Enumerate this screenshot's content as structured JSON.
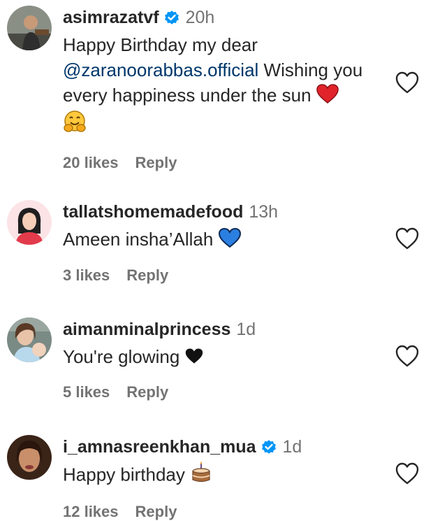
{
  "comments": [
    {
      "username": "asimrazatvf",
      "verified": true,
      "time": "20h",
      "text_line1": "Happy Birthday my dear",
      "mention": "@zaranoorabbas.official",
      "text_after_mention": " Wishing you every happiness under the sun",
      "likes": "20 likes",
      "reply": "Reply"
    },
    {
      "username": "tallatshomemadefood",
      "verified": false,
      "time": "13h",
      "text": "Ameen insha’Allah",
      "likes": "3 likes",
      "reply": "Reply"
    },
    {
      "username": "aimanminalprincess",
      "verified": false,
      "time": "1d",
      "text": "You're glowing",
      "likes": "5 likes",
      "reply": "Reply"
    },
    {
      "username": "i_amnasreenkhan_mua",
      "verified": true,
      "time": "1d",
      "text": "Happy birthday",
      "likes": "12 likes",
      "reply": "Reply"
    }
  ],
  "colors": {
    "username": "#262626",
    "secondary": "#737373",
    "mention": "#00376b",
    "verified_badge": "#0095f6"
  }
}
